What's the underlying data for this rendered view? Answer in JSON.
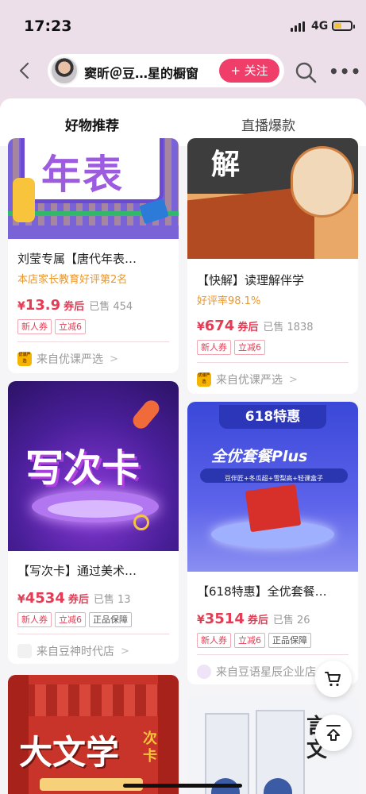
{
  "status": {
    "time": "17:23",
    "network": "4G"
  },
  "nav": {
    "shop_name": "窦昕＠豆…星的橱窗",
    "follow_label": "+ 关注"
  },
  "tabs": [
    {
      "label": "好物推荐"
    },
    {
      "label": "直播爆款"
    }
  ],
  "products": [
    {
      "art_text": "年表",
      "title": "刘莹专属【唐代年表…",
      "rank": "本店家长教育好评第2名",
      "currency": "¥",
      "price": "13.9",
      "price_suffix": "券后",
      "sold": "已售 454",
      "tags": [
        "新人券",
        "立减6"
      ],
      "source": "来自优课严选",
      "source_logo_text": "优课严选"
    },
    {
      "art_text": "解",
      "title": "【快解】读理解伴学",
      "rank": "好评率98.1%",
      "currency": "¥",
      "price": "674",
      "price_suffix": "券后",
      "sold": "已售 1838",
      "tags": [
        "新人券",
        "立减6"
      ],
      "source": "来自优课严选",
      "source_logo_text": "优课严选"
    },
    {
      "art_text": "写次卡",
      "title": "【写次卡】通过美术…",
      "currency": "¥",
      "price": "4534",
      "price_suffix": "券后",
      "sold": "已售 13",
      "tags": [
        "新人券",
        "立减6",
        "正品保障"
      ],
      "source": "来自豆神时代店"
    },
    {
      "art_banner": "618特惠",
      "art_title": "全优套餐Plus",
      "art_sub": "豆伴匠+冬瓜超+雪梨高+轻课盒子",
      "title": "【618特惠】全优套餐…",
      "currency": "¥",
      "price": "3514",
      "price_suffix": "券后",
      "sold": "已售 26",
      "tags": [
        "新人券",
        "立减6",
        "正品保障"
      ],
      "source": "来自豆语星辰企业店"
    },
    {
      "art_text": "大文学",
      "art_sub": "次卡"
    },
    {
      "art_text": "言文"
    }
  ],
  "colors": {
    "accent": "#ef3e6a",
    "price": "#e23d55",
    "rank": "#e9962c"
  },
  "icons": [
    "back-icon",
    "search-icon",
    "more-icon",
    "cart-icon",
    "back-to-top-icon"
  ]
}
